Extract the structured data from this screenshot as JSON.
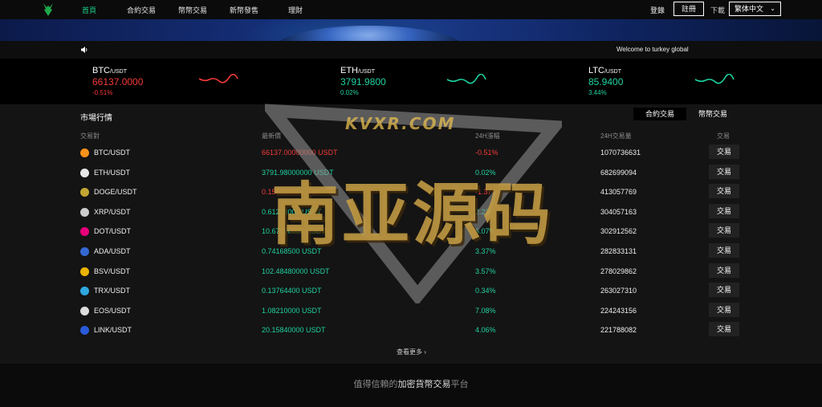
{
  "nav": {
    "items": [
      {
        "label": "首頁",
        "active": true
      },
      {
        "label": "合約交易"
      },
      {
        "label": "幣幣交易"
      },
      {
        "label": "新幣發售"
      },
      {
        "label": "理財"
      }
    ],
    "login": "登錄",
    "register": "註冊",
    "download": "下載",
    "language": "繁体中文"
  },
  "notice": {
    "text": "Welcome to turkey global"
  },
  "tickers": [
    {
      "base": "BTC",
      "quote": "/USDT",
      "price": "66137.0000",
      "change": "-0.51%",
      "trend": "down"
    },
    {
      "base": "ETH",
      "quote": "/USDT",
      "price": "3791.9800",
      "change": "0.02%",
      "trend": "up"
    },
    {
      "base": "LTC",
      "quote": "/USDT",
      "price": "85.9400",
      "change": "3.44%",
      "trend": "up"
    }
  ],
  "market": {
    "title": "市場行情",
    "tabs": [
      "合約交易",
      "幣幣交易"
    ],
    "headers": {
      "pair": "交易對",
      "price": "最新價",
      "change": "24H漲幅",
      "volume": "24H交易量",
      "action": "交易"
    },
    "trade_label": "交易",
    "rows": [
      {
        "pair": "BTC/USDT",
        "price": "66137.00000000 USDT",
        "change": "-0.51%",
        "volume": "1070736631",
        "dir": "down",
        "icon": "btc-icon",
        "color": "#f7931a"
      },
      {
        "pair": "ETH/USDT",
        "price": "3791.98000000 USDT",
        "change": "0.02%",
        "volume": "682699094",
        "dir": "up",
        "icon": "eth-icon",
        "color": "#e6e6e6"
      },
      {
        "pair": "DOGE/USDT",
        "price": "0.15038000 USDT",
        "change": "-1.37%",
        "volume": "413057769",
        "dir": "down",
        "icon": "doge-icon",
        "color": "#c2a633"
      },
      {
        "pair": "XRP/USDT",
        "price": "0.61228000 USDT",
        "change": "2.23%",
        "volume": "304057163",
        "dir": "up",
        "icon": "xrp-icon",
        "color": "#cccccc"
      },
      {
        "pair": "DOT/USDT",
        "price": "10.67590000 USDT",
        "change": "6.07%",
        "volume": "302912562",
        "dir": "up",
        "icon": "dot-icon",
        "color": "#e6007a"
      },
      {
        "pair": "ADA/USDT",
        "price": "0.74168500 USDT",
        "change": "3.37%",
        "volume": "282833131",
        "dir": "up",
        "icon": "ada-icon",
        "color": "#3468d1"
      },
      {
        "pair": "BSV/USDT",
        "price": "102.48480000 USDT",
        "change": "3.57%",
        "volume": "278029862",
        "dir": "up",
        "icon": "bsv-icon",
        "color": "#eab300"
      },
      {
        "pair": "TRX/USDT",
        "price": "0.13764400 USDT",
        "change": "0.34%",
        "volume": "263027310",
        "dir": "up",
        "icon": "trx-icon",
        "color": "#2fa8e0"
      },
      {
        "pair": "EOS/USDT",
        "price": "1.08210000 USDT",
        "change": "7.08%",
        "volume": "224243156",
        "dir": "up",
        "icon": "eos-icon",
        "color": "#dddddd"
      },
      {
        "pair": "LINK/USDT",
        "price": "20.15840000 USDT",
        "change": "4.06%",
        "volume": "221788082",
        "dir": "up",
        "icon": "link-icon",
        "color": "#2a5ada"
      }
    ],
    "more": "查看更多 ›"
  },
  "footer": {
    "slogan_pre": "值得信賴的",
    "slogan_hl": "加密貨幣交易",
    "slogan_post": "平台"
  },
  "watermark": {
    "site": "KVXR.COM",
    "text": "南亚源码"
  },
  "colors": {
    "up": "#1fd2a0",
    "down": "#f43a3a",
    "nav_active": "#1fd28c"
  }
}
